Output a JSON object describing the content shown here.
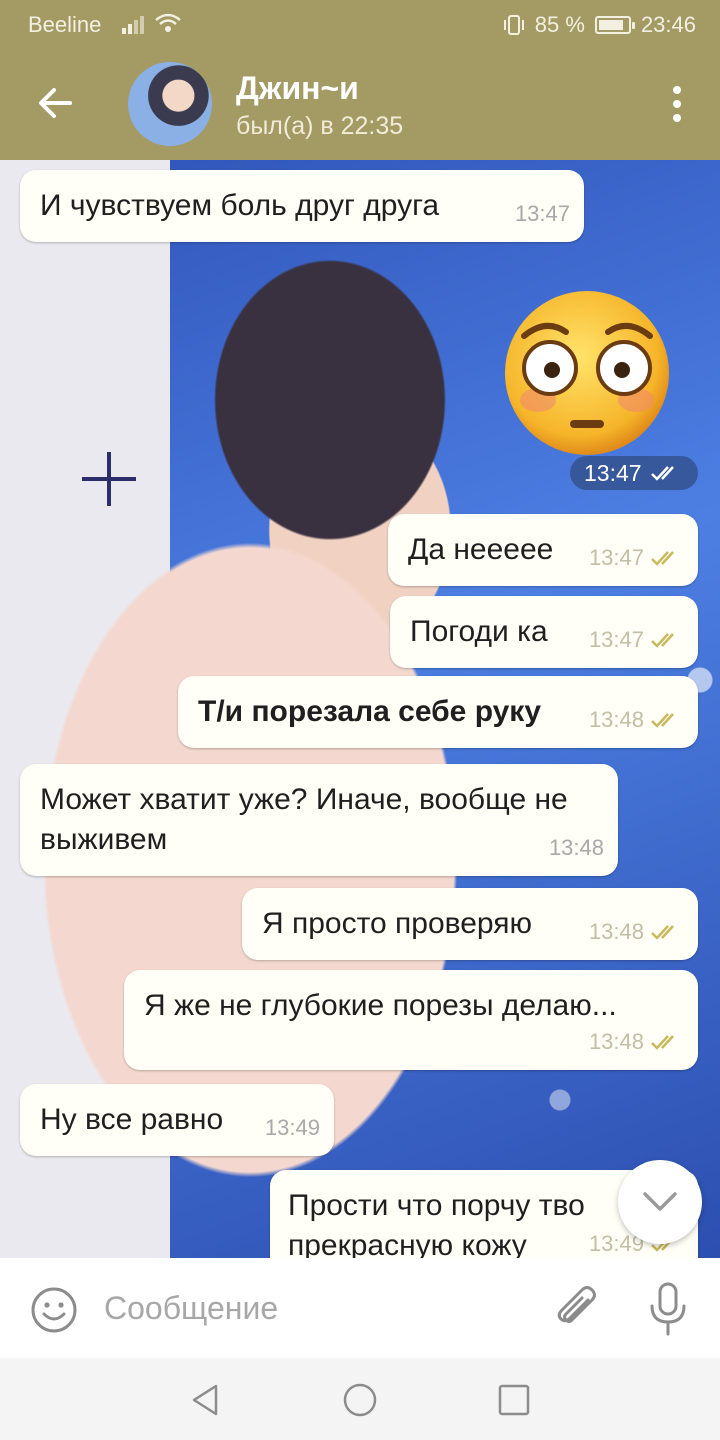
{
  "status_bar": {
    "carrier": "Beeline",
    "battery_percent": "85 %",
    "battery_level": 0.85,
    "time": "23:46"
  },
  "header": {
    "contact_name": "Джин~и",
    "last_seen": "был(а) в 22:35"
  },
  "messages": [
    {
      "direction": "in",
      "text": "И чувствуем боль друг друга",
      "time": "13:47"
    },
    {
      "direction": "out",
      "type": "sticker",
      "sticker": "flushed-face-emoji",
      "time": "13:47",
      "status": "read"
    },
    {
      "direction": "out",
      "text": "Да нееееe",
      "time": "13:47",
      "status": "read"
    },
    {
      "direction": "out",
      "text": "Погоди ка",
      "time": "13:47",
      "status": "read"
    },
    {
      "direction": "out",
      "text": "Т/и порезала себе руку",
      "bold": true,
      "time": "13:48",
      "status": "read"
    },
    {
      "direction": "in",
      "text": "Может хватит уже? Иначе, вообще не выживем",
      "time": "13:48"
    },
    {
      "direction": "out",
      "text": "Я просто проверяю",
      "time": "13:48",
      "status": "read"
    },
    {
      "direction": "out",
      "text": "Я же не глубокие порезы делаю...",
      "time": "13:48",
      "status": "read"
    },
    {
      "direction": "in",
      "text": "Ну все равно",
      "time": "13:49"
    },
    {
      "direction": "out",
      "text": "Прости что порчу тво прекрасную кожу",
      "time": "13:49",
      "status": "read"
    }
  ],
  "input": {
    "placeholder": "Сообщение",
    "value": ""
  },
  "colors": {
    "header_bg": "#a39a64",
    "bubble_bg": "#fffef7",
    "read_tick": "#c9b95a"
  }
}
